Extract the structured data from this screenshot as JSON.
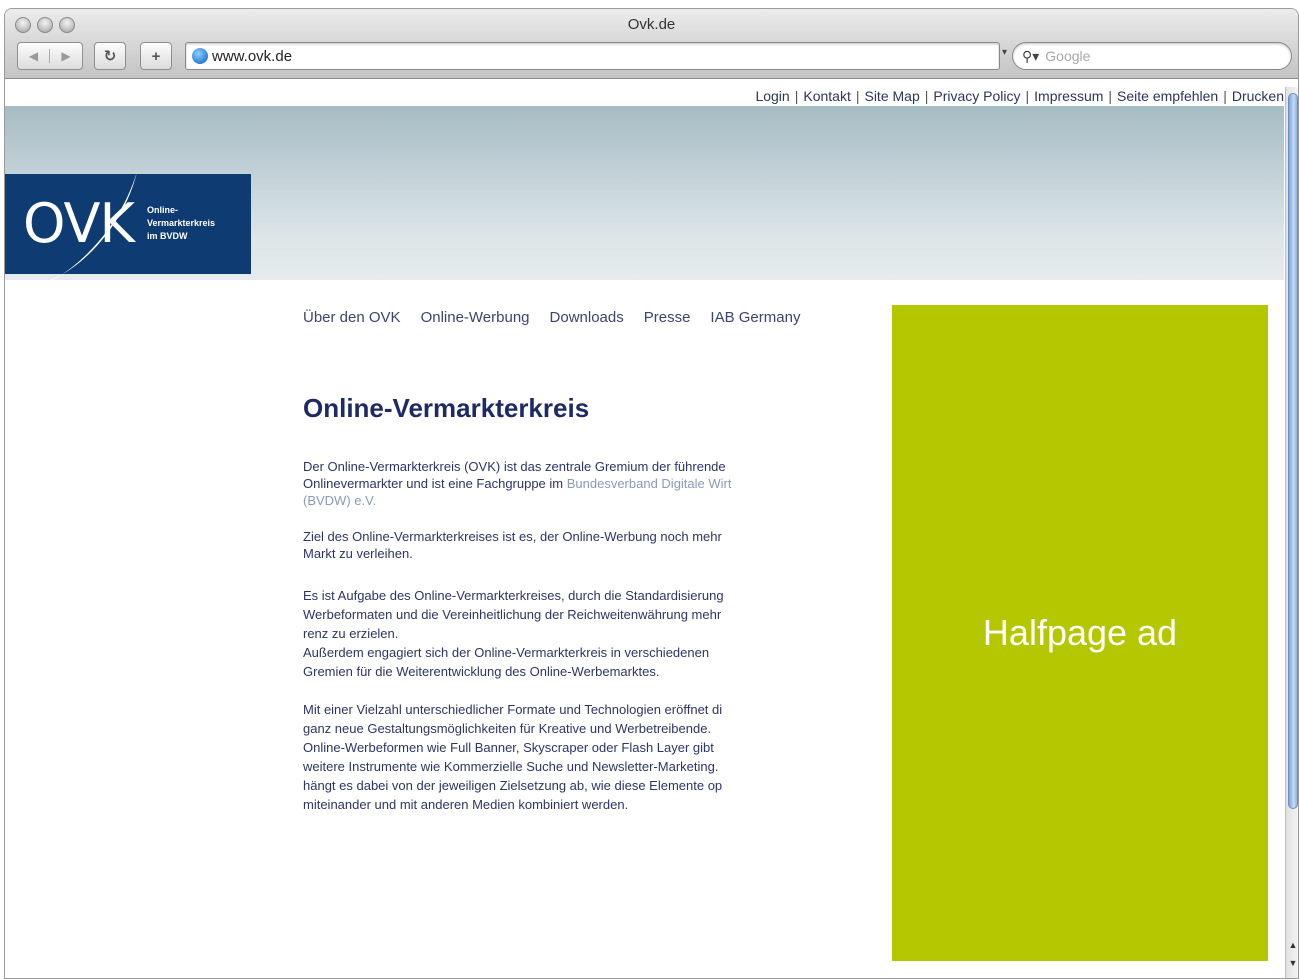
{
  "window": {
    "title": "Ovk.de",
    "url": "www.ovk.de",
    "search_placeholder": "Google"
  },
  "utility_nav": [
    "Login",
    "Kontakt",
    "Site Map",
    "Privacy Policy",
    "Impressum",
    "Seite empfehlen",
    "Drucken"
  ],
  "logo": {
    "text": "OVK",
    "tagline_lines": [
      "Online-",
      "Vermarkterkreis",
      "im BVDW"
    ]
  },
  "main_nav": [
    "Über den OVK",
    "Online-Werbung",
    "Downloads",
    "Presse",
    "IAB Germany"
  ],
  "content": {
    "headline": "Online-Vermarkterkreis",
    "p1": {
      "line1": "Der Online-Vermarkterkreis (OVK) ist das zentrale Gremium der führende",
      "line2_text": "Onlinevermarkter und ist eine Fachgruppe im ",
      "line2_link": "Bundesverband Digitale Wirt",
      "line3_link": "(BVDW) e.V."
    },
    "p2": [
      "Ziel des Online-Vermarkterkreises ist es, der Online-Werbung noch mehr",
      "Markt zu verleihen."
    ],
    "p3": [
      "Es ist Aufgabe des Online-Vermarkterkreises, durch die Standardisierung",
      "Werbeformaten und die Vereinheitlichung der Reichweitenwährung mehr",
      "renz zu erzielen.",
      "Außerdem engagiert sich der Online-Vermarkterkreis in verschiedenen",
      "Gremien für die Weiterentwicklung des Online-Werbemarktes."
    ],
    "p4": [
      "Mit einer Vielzahl unterschiedlicher Formate und Technologien eröffnet di",
      "ganz neue Gestaltungsmöglichkeiten für Kreative und Werbetreibende.",
      "Online-Werbeformen wie Full Banner, Skyscraper oder Flash Layer gibt",
      "weitere Instrumente wie Kommerzielle Suche und Newsletter-Marketing.",
      "hängt es dabei von der jeweiligen Zielsetzung ab, wie diese Elemente op",
      "miteinander und mit anderen Medien kombiniert werden."
    ]
  },
  "ad": {
    "label": "Halfpage ad",
    "color": "#b4c700"
  },
  "colors": {
    "logo_bg": "#0f3b73",
    "text": "#2c3566"
  },
  "icons": {
    "back": "back-arrow-icon",
    "forward": "forward-arrow-icon",
    "reload": "reload-icon",
    "add": "plus-icon",
    "site": "globe-icon",
    "search": "magnifier-icon"
  }
}
